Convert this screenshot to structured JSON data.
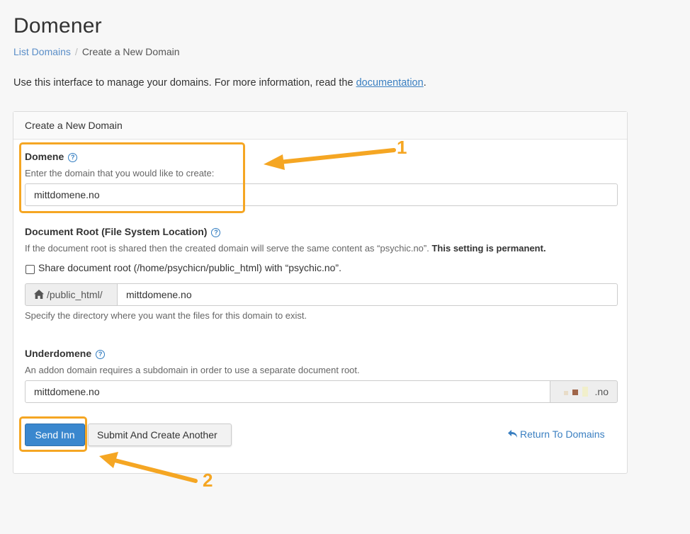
{
  "page": {
    "title": "Domener",
    "breadcrumb": {
      "link": "List Domains",
      "separator": "/",
      "current": "Create a New Domain"
    },
    "intro_text": "Use this interface to manage your domains. For more information, read the ",
    "intro_link": "documentation",
    "intro_end": "."
  },
  "panel": {
    "heading": "Create a New Domain",
    "domain": {
      "label": "Domene",
      "hint": "Enter the domain that you would like to create:",
      "value": "mittdomene.no"
    },
    "docroot": {
      "label": "Document Root (File System Location)",
      "hint": "If the document root is shared then the created domain will serve the same content as “psychic.no”.",
      "hint_bold": "This setting is permanent.",
      "share_label": "Share document root (/home/psychicn/public_html) with “psychic.no”.",
      "prefix": "/public_html/",
      "value": "mittdomene.no",
      "help_text": "Specify the directory where you want the files for this domain to exist."
    },
    "subdomain": {
      "label": "Underdomene",
      "hint": "An addon domain requires a subdomain in order to use a separate document root.",
      "value": "mittdomene.no",
      "suffix": ".no"
    },
    "buttons": {
      "submit": "Send Inn",
      "submit_another": "Submit And Create Another",
      "return": "Return To Domains"
    }
  },
  "annotations": {
    "step1": "1",
    "step2": "2",
    "color": "#f5a623"
  },
  "colors": {
    "primary": "#3a87ce",
    "link": "#3a7fc1",
    "highlight": "#f5a623"
  },
  "icons": [
    "help-icon",
    "home-icon",
    "undo-icon"
  ]
}
